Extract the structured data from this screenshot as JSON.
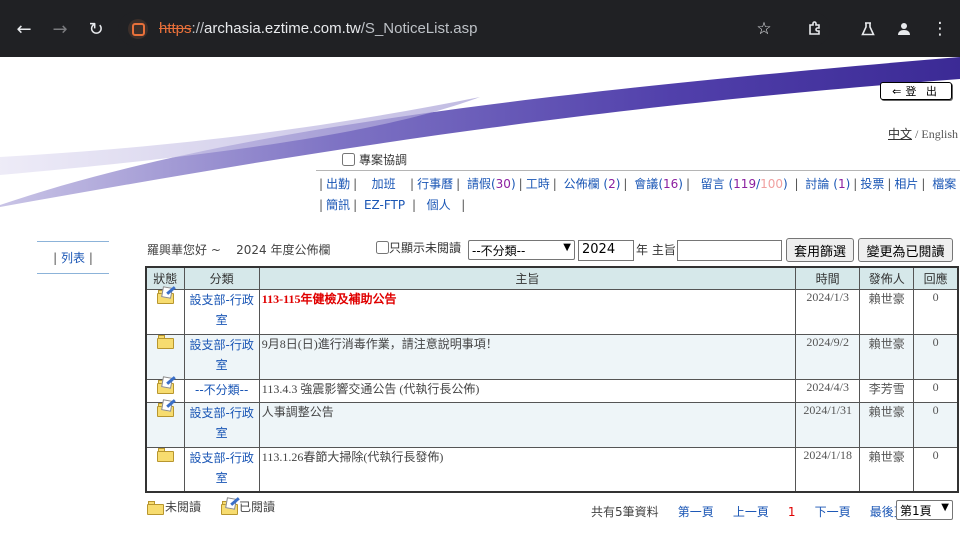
{
  "browser": {
    "url_scheme": "https",
    "url_sep": "://",
    "url_host": "archasia.eztime.com.tw",
    "url_path": "/S_NoticeList.asp",
    "icons": [
      "back-arrow-icon",
      "forward-arrow-icon",
      "reload-icon",
      "site-info-icon",
      "star-icon",
      "extensions-icon",
      "labs-flask-icon",
      "profile-icon",
      "more-menu-icon"
    ]
  },
  "header": {
    "logout_label": "登 出",
    "lang_zh": "中文",
    "lang_sep": " / ",
    "lang_en": "English",
    "project_checkbox_label": "專案協調"
  },
  "menu": {
    "row1": [
      {
        "label": "出勤",
        "count": ""
      },
      {
        "label": "加班",
        "count": ""
      },
      {
        "label": "行事曆",
        "count": ""
      },
      {
        "label": "請假",
        "count": "30"
      },
      {
        "label": "工時",
        "count": ""
      },
      {
        "label": "公佈欄",
        "count": "2"
      },
      {
        "label": "會議",
        "count": "16"
      },
      {
        "label": "留言",
        "count": "119",
        "count2": "100"
      },
      {
        "label": "討論",
        "count": "1"
      },
      {
        "label": "投票",
        "count": ""
      },
      {
        "label": "相片",
        "count": ""
      },
      {
        "label": "檔案",
        "count": "134"
      }
    ],
    "row2": [
      {
        "label": "簡訊"
      },
      {
        "label": "EZ-FTP"
      },
      {
        "label": "個人"
      }
    ]
  },
  "sidebar": {
    "list_label": "列表"
  },
  "toolbar": {
    "greeting": "羅興華您好 ~",
    "board_title": "2024 年度公佈欄",
    "unread_only_label": "只顯示未閱讀",
    "category_selected": "--不分類--",
    "year_value": "2024",
    "year_suffix": "年",
    "subject_label": "主旨:",
    "subject_value": "",
    "filter_button": "套用篩選",
    "mark_read_button": "變更為已閱讀"
  },
  "table": {
    "headers": [
      "狀態",
      "分類",
      "主旨",
      "時間",
      "發佈人",
      "回應"
    ],
    "rows": [
      {
        "status": "read",
        "category": "設支部-行政室",
        "subject": "113-115年健檢及補助公告",
        "highlight": true,
        "time": "2024/1/3",
        "author": "賴世豪",
        "replies": "0"
      },
      {
        "status": "unread",
        "category": "設支部-行政室",
        "subject": "9月8日(日)進行消毒作業，請注意說明事項！",
        "highlight": false,
        "time": "2024/9/2",
        "author": "賴世豪",
        "replies": "0"
      },
      {
        "status": "read",
        "category": "--不分類--",
        "subject": "113.4.3 強震影響交通公告 (代執行長公佈)",
        "highlight": false,
        "time": "2024/4/3",
        "author": "李芳雪",
        "replies": "0"
      },
      {
        "status": "read",
        "category": "設支部-行政室",
        "subject": "人事調整公告",
        "highlight": false,
        "time": "2024/1/31",
        "author": "賴世豪",
        "replies": "0"
      },
      {
        "status": "unread",
        "category": "設支部-行政室",
        "subject": "113.1.26春節大掃除(代執行長發佈)",
        "highlight": false,
        "time": "2024/1/18",
        "author": "賴世豪",
        "replies": "0"
      }
    ]
  },
  "footer": {
    "legend_unread": "未閱讀",
    "legend_read": "已閱讀",
    "total_text": "共有5筆資料",
    "first_page": "第一頁",
    "prev_page": "上一頁",
    "current_page": "1",
    "next_page": "下一頁",
    "last_page": "最後頁",
    "page_select": "第1頁"
  },
  "colors": {
    "banner_purple": "#5b4cb0",
    "link_blue": "#1a56b5",
    "highlight_red": "#e00000",
    "header_bg": "#d6e8ea"
  }
}
